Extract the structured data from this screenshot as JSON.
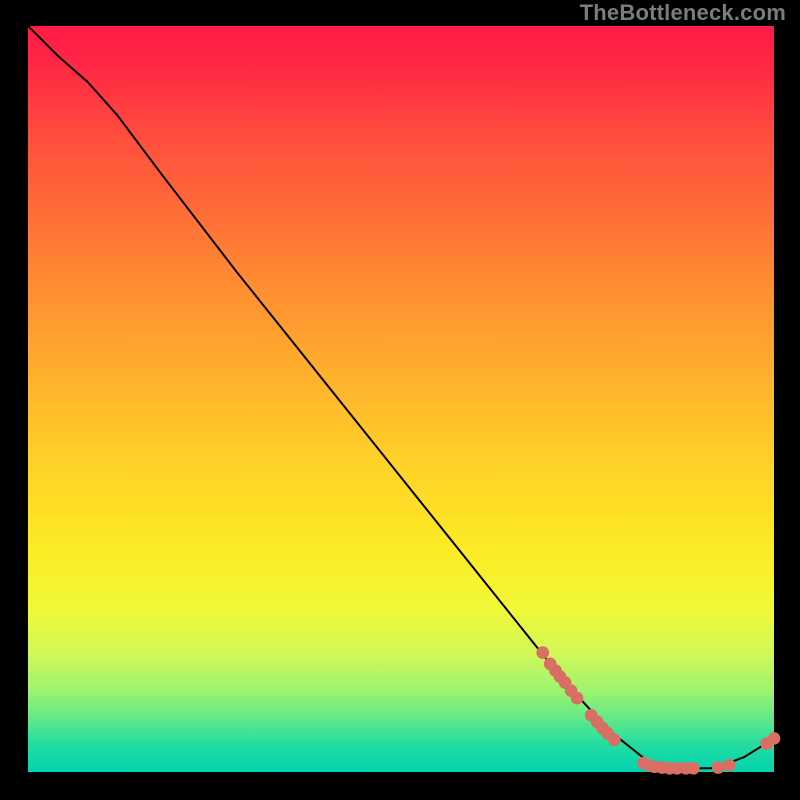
{
  "watermark": "TheBottleneck.com",
  "chart_data": {
    "type": "line",
    "title": "",
    "xlabel": "",
    "ylabel": "",
    "xlim": [
      0,
      100
    ],
    "ylim": [
      0,
      100
    ],
    "grid": false,
    "legend": false,
    "curve": [
      {
        "x": 0.0,
        "y": 100.0
      },
      {
        "x": 4.0,
        "y": 96.0
      },
      {
        "x": 8.0,
        "y": 92.5
      },
      {
        "x": 12.0,
        "y": 88.0
      },
      {
        "x": 18.0,
        "y": 80.0
      },
      {
        "x": 28.0,
        "y": 67.0
      },
      {
        "x": 40.0,
        "y": 52.0
      },
      {
        "x": 52.0,
        "y": 37.0
      },
      {
        "x": 64.0,
        "y": 22.0
      },
      {
        "x": 72.0,
        "y": 12.0
      },
      {
        "x": 78.0,
        "y": 5.5
      },
      {
        "x": 83.0,
        "y": 1.5
      },
      {
        "x": 88.0,
        "y": 0.5
      },
      {
        "x": 92.0,
        "y": 0.5
      },
      {
        "x": 96.0,
        "y": 2.0
      },
      {
        "x": 100.0,
        "y": 4.5
      }
    ],
    "scatter_points": [
      {
        "x": 69.0,
        "y": 16.0
      },
      {
        "x": 70.0,
        "y": 14.5
      },
      {
        "x": 70.7,
        "y": 13.6
      },
      {
        "x": 71.3,
        "y": 12.8
      },
      {
        "x": 72.0,
        "y": 12.0
      },
      {
        "x": 72.8,
        "y": 10.9
      },
      {
        "x": 73.6,
        "y": 9.9
      },
      {
        "x": 75.5,
        "y": 7.6
      },
      {
        "x": 76.3,
        "y": 6.7
      },
      {
        "x": 77.0,
        "y": 5.9
      },
      {
        "x": 77.7,
        "y": 5.2
      },
      {
        "x": 78.6,
        "y": 4.3
      },
      {
        "x": 82.5,
        "y": 1.2
      },
      {
        "x": 83.2,
        "y": 0.9
      },
      {
        "x": 84.0,
        "y": 0.7
      },
      {
        "x": 85.0,
        "y": 0.6
      },
      {
        "x": 86.0,
        "y": 0.5
      },
      {
        "x": 87.0,
        "y": 0.5
      },
      {
        "x": 88.2,
        "y": 0.5
      },
      {
        "x": 89.2,
        "y": 0.5
      },
      {
        "x": 92.5,
        "y": 0.6
      },
      {
        "x": 94.0,
        "y": 0.9
      },
      {
        "x": 99.0,
        "y": 3.8
      },
      {
        "x": 100.0,
        "y": 4.5
      }
    ],
    "colors": {
      "curve": "#000000",
      "points": "#d96f64"
    }
  }
}
